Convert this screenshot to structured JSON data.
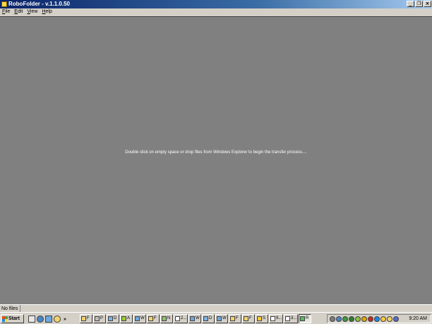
{
  "window": {
    "title": "RoboFolder - v.1.1.0.50",
    "controls": [
      "minimize-icon",
      "restore-icon",
      "close-icon"
    ]
  },
  "menu": [
    {
      "label": "File",
      "mnemonic": "F",
      "rest": "ile"
    },
    {
      "label": "Edit",
      "mnemonic": "E",
      "rest": "dit"
    },
    {
      "label": "View",
      "mnemonic": "V",
      "rest": "iew"
    },
    {
      "label": "Help",
      "mnemonic": "H",
      "rest": "elp"
    }
  ],
  "main": {
    "hint": "Double click on empty space or drop files from Windows Explorer to begin the transfer process...."
  },
  "statusbar": {
    "text": "No files"
  },
  "taskbar": {
    "start_label": "Start",
    "quicklaunch_more": "»",
    "tasks": [
      {
        "icon": "folder-icon",
        "label": "F",
        "color": "#f4d36b"
      },
      {
        "icon": "program-icon",
        "label": "P",
        "color": "#bfbfbf"
      },
      {
        "icon": "document-icon",
        "label": "D",
        "color": "#7fb3e0"
      },
      {
        "icon": "app-icon",
        "label": "A",
        "color": "#9acd32"
      },
      {
        "icon": "window-icon",
        "label": "W",
        "color": "#6fa8dc"
      },
      {
        "icon": "folder-icon",
        "label": "F",
        "color": "#f4d36b"
      },
      {
        "icon": "network-icon",
        "label": "N",
        "color": "#8fbf6f"
      },
      {
        "icon": "text-icon",
        "label": "2...",
        "color": "#ffffff"
      },
      {
        "icon": "window-icon",
        "label": "W",
        "color": "#6fa8dc"
      },
      {
        "icon": "document-icon",
        "label": "D",
        "color": "#7fb3e0"
      },
      {
        "icon": "window-icon",
        "label": "W",
        "color": "#6fa8dc"
      },
      {
        "icon": "folder-icon",
        "label": "F",
        "color": "#f4d36b"
      },
      {
        "icon": "folder-icon",
        "label": "F",
        "color": "#f4d36b"
      },
      {
        "icon": "smiley-icon",
        "label": "S",
        "color": "#ffcc33"
      },
      {
        "icon": "text-icon",
        "label": "9...",
        "color": "#ffffff"
      },
      {
        "icon": "text-icon",
        "label": "3...",
        "color": "#ffffff"
      },
      {
        "icon": "robofolder-icon",
        "label": "R",
        "color": "#5cb85c",
        "active": true
      }
    ],
    "tray_icons": [
      {
        "icon": "speaker-icon",
        "color": "#7f7f7f"
      },
      {
        "icon": "network-icon",
        "color": "#4a86c5"
      },
      {
        "icon": "shield-icon",
        "color": "#3b9c3b"
      },
      {
        "icon": "globe-icon",
        "color": "#2e7d32"
      },
      {
        "icon": "leaf-icon",
        "color": "#8bc34a"
      },
      {
        "icon": "warning-icon",
        "color": "#e0a800"
      },
      {
        "icon": "antivirus-icon",
        "color": "#c62828"
      },
      {
        "icon": "sync-icon",
        "color": "#1e88e5"
      },
      {
        "icon": "smiley-icon",
        "color": "#ffcc33"
      },
      {
        "icon": "mail-icon",
        "color": "#f4d36b"
      },
      {
        "icon": "monitor-icon",
        "color": "#5c6bc0"
      }
    ],
    "clock": "9:20 AM"
  },
  "colors": {
    "desktop": "#808080",
    "chrome": "#d4d0c8",
    "titlebar_start": "#0a246a",
    "titlebar_end": "#a6caf0"
  }
}
